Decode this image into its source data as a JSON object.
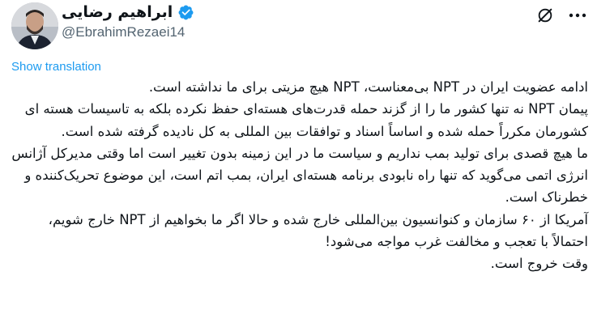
{
  "author": {
    "display_name": "ابراهیم رضایی",
    "handle": "@EbrahimRezaei14",
    "verified": true,
    "avatar_icon": "profile-photo",
    "verified_icon": "verified-badge-icon"
  },
  "actions": {
    "grok_icon": "grok-icon",
    "more_icon": "more-horizontal-icon"
  },
  "translation": {
    "label": "Show translation"
  },
  "tweet": {
    "text": "ادامه عضویت ایران در NPT بی‌معناست، NPT هیچ مزیتی برای ما نداشته است.\nپیمان NPT نه تنها کشور ما را از گزند حمله قدرت‌های هسته‌ای حفظ نکرده بلکه به تاسیسات هسته ای کشورمان مکرراً حمله شده و اساساً اسناد و توافقات بین المللی به کل نادیده گرفته شده است.\nما هیچ قصدی برای تولید بمب نداریم و سیاست ما در این زمینه بدون تغییر است اما وقتی مدیرکل آژانس انرژی اتمی می‌گوید که تنها راه نابودی برنامه هسته‌ای ایران، بمب اتم است، این موضوع تحریک‌کننده و خطرناک است.\nآمریکا از ۶۰ سازمان و کنوانسیون بین‌المللی خارج شده و حالا اگر ما بخواهیم از NPT خارج شویم، احتمالاً با تعجب و مخالفت غرب مواجه می‌شود!\nوقت خروج است."
  },
  "colors": {
    "text": "#0f1419",
    "secondary": "#536471",
    "accent": "#1d9bf0"
  }
}
